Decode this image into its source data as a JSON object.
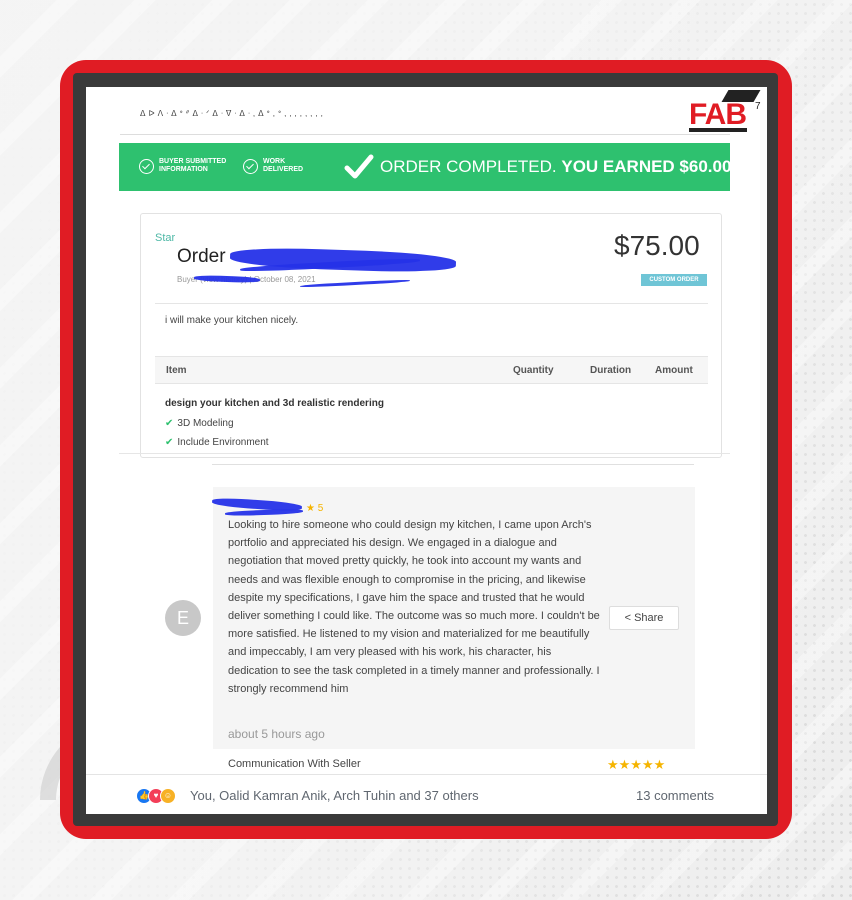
{
  "brand": {
    "logo_text": "FAB",
    "tassel": "7"
  },
  "header": {
    "scribble": "ᐃᐅᐱᐧᐃᐤᐥᐃᐧᐟᐃᐧᐁᐧᐃᐧ,ᐃᐤ,ᐤ,,,,,,,,"
  },
  "banner": {
    "step1": "BUYER SUBMITTED\nINFORMATION",
    "step2": "WORK\nDELIVERED",
    "message_prefix": "ORDER COMPLETED. ",
    "message_bold": "YOU EARNED $60.00",
    "color": "#2ec16f"
  },
  "order": {
    "star_label": "Star",
    "title": "Order",
    "buyer_line": "Buyer                     (view history)  |  October 08, 2021",
    "price": "$75.00",
    "badge": "CUSTOM ORDER",
    "description": "i will make your kitchen nicely.",
    "columns": [
      "Item",
      "Quantity",
      "Duration",
      "Amount"
    ],
    "item_name": "design your kitchen and 3d realistic rendering",
    "features": [
      "3D Modeling",
      "Include Environment"
    ]
  },
  "review": {
    "avatar_letter": "E",
    "rating": "5",
    "text": "Looking to hire someone who could design my kitchen, I came upon Arch's portfolio and appreciated his design. We engaged in a dialogue and negotiation that moved pretty quickly, he took into account my wants and needs and was flexible enough to compromise in the pricing, and likewise despite my specifications, I gave him the space and trusted that he would deliver something I could like. The outcome was so much more. I couldn't be more satisfied. He listened to my vision and materialized for me beautifully and impeccably, I am very pleased with his work, his character, his dedication to see the task completed in a timely manner and professionally. I strongly recommend him",
    "time": "about 5 hours ago",
    "share_label": "Share",
    "communication_label": "Communication With Seller",
    "communication_stars": "★★★★★"
  },
  "facebook": {
    "reactions": [
      "like-icon",
      "love-icon",
      "care-icon"
    ],
    "names": "You, Oalid Kamran Anik, Arch Tuhin and 37 others",
    "comments": "13 comments"
  }
}
